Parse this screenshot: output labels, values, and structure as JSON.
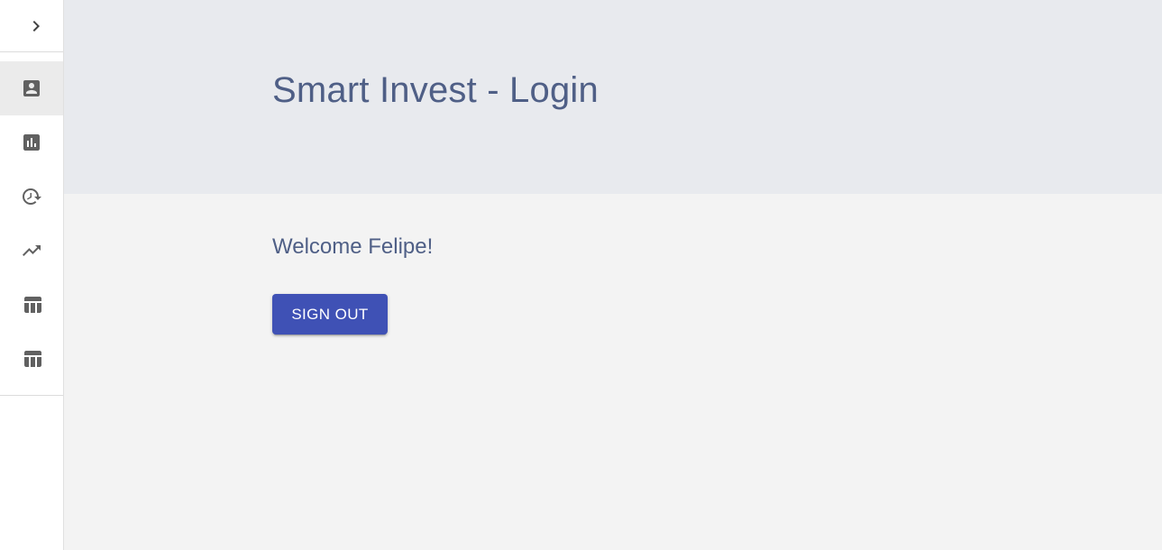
{
  "sidebar": {
    "toggle_icon": "chevron-right-icon",
    "items": [
      {
        "icon": "account-box-icon",
        "active": true
      },
      {
        "icon": "assessment-icon",
        "active": false
      },
      {
        "icon": "history-icon",
        "active": false
      },
      {
        "icon": "trending-up-icon",
        "active": false
      },
      {
        "icon": "table-icon",
        "active": false
      },
      {
        "icon": "table-icon",
        "active": false
      }
    ]
  },
  "header": {
    "title": "Smart Invest - Login"
  },
  "main": {
    "welcome": "Welcome Felipe!",
    "sign_out_label": "Sign Out"
  },
  "colors": {
    "accent": "#3f51b5",
    "title_text": "#4f5f86",
    "header_bg": "#e8eaee",
    "content_bg": "#f3f3f3",
    "icon": "#616161",
    "active_item_bg": "#ebebeb"
  }
}
